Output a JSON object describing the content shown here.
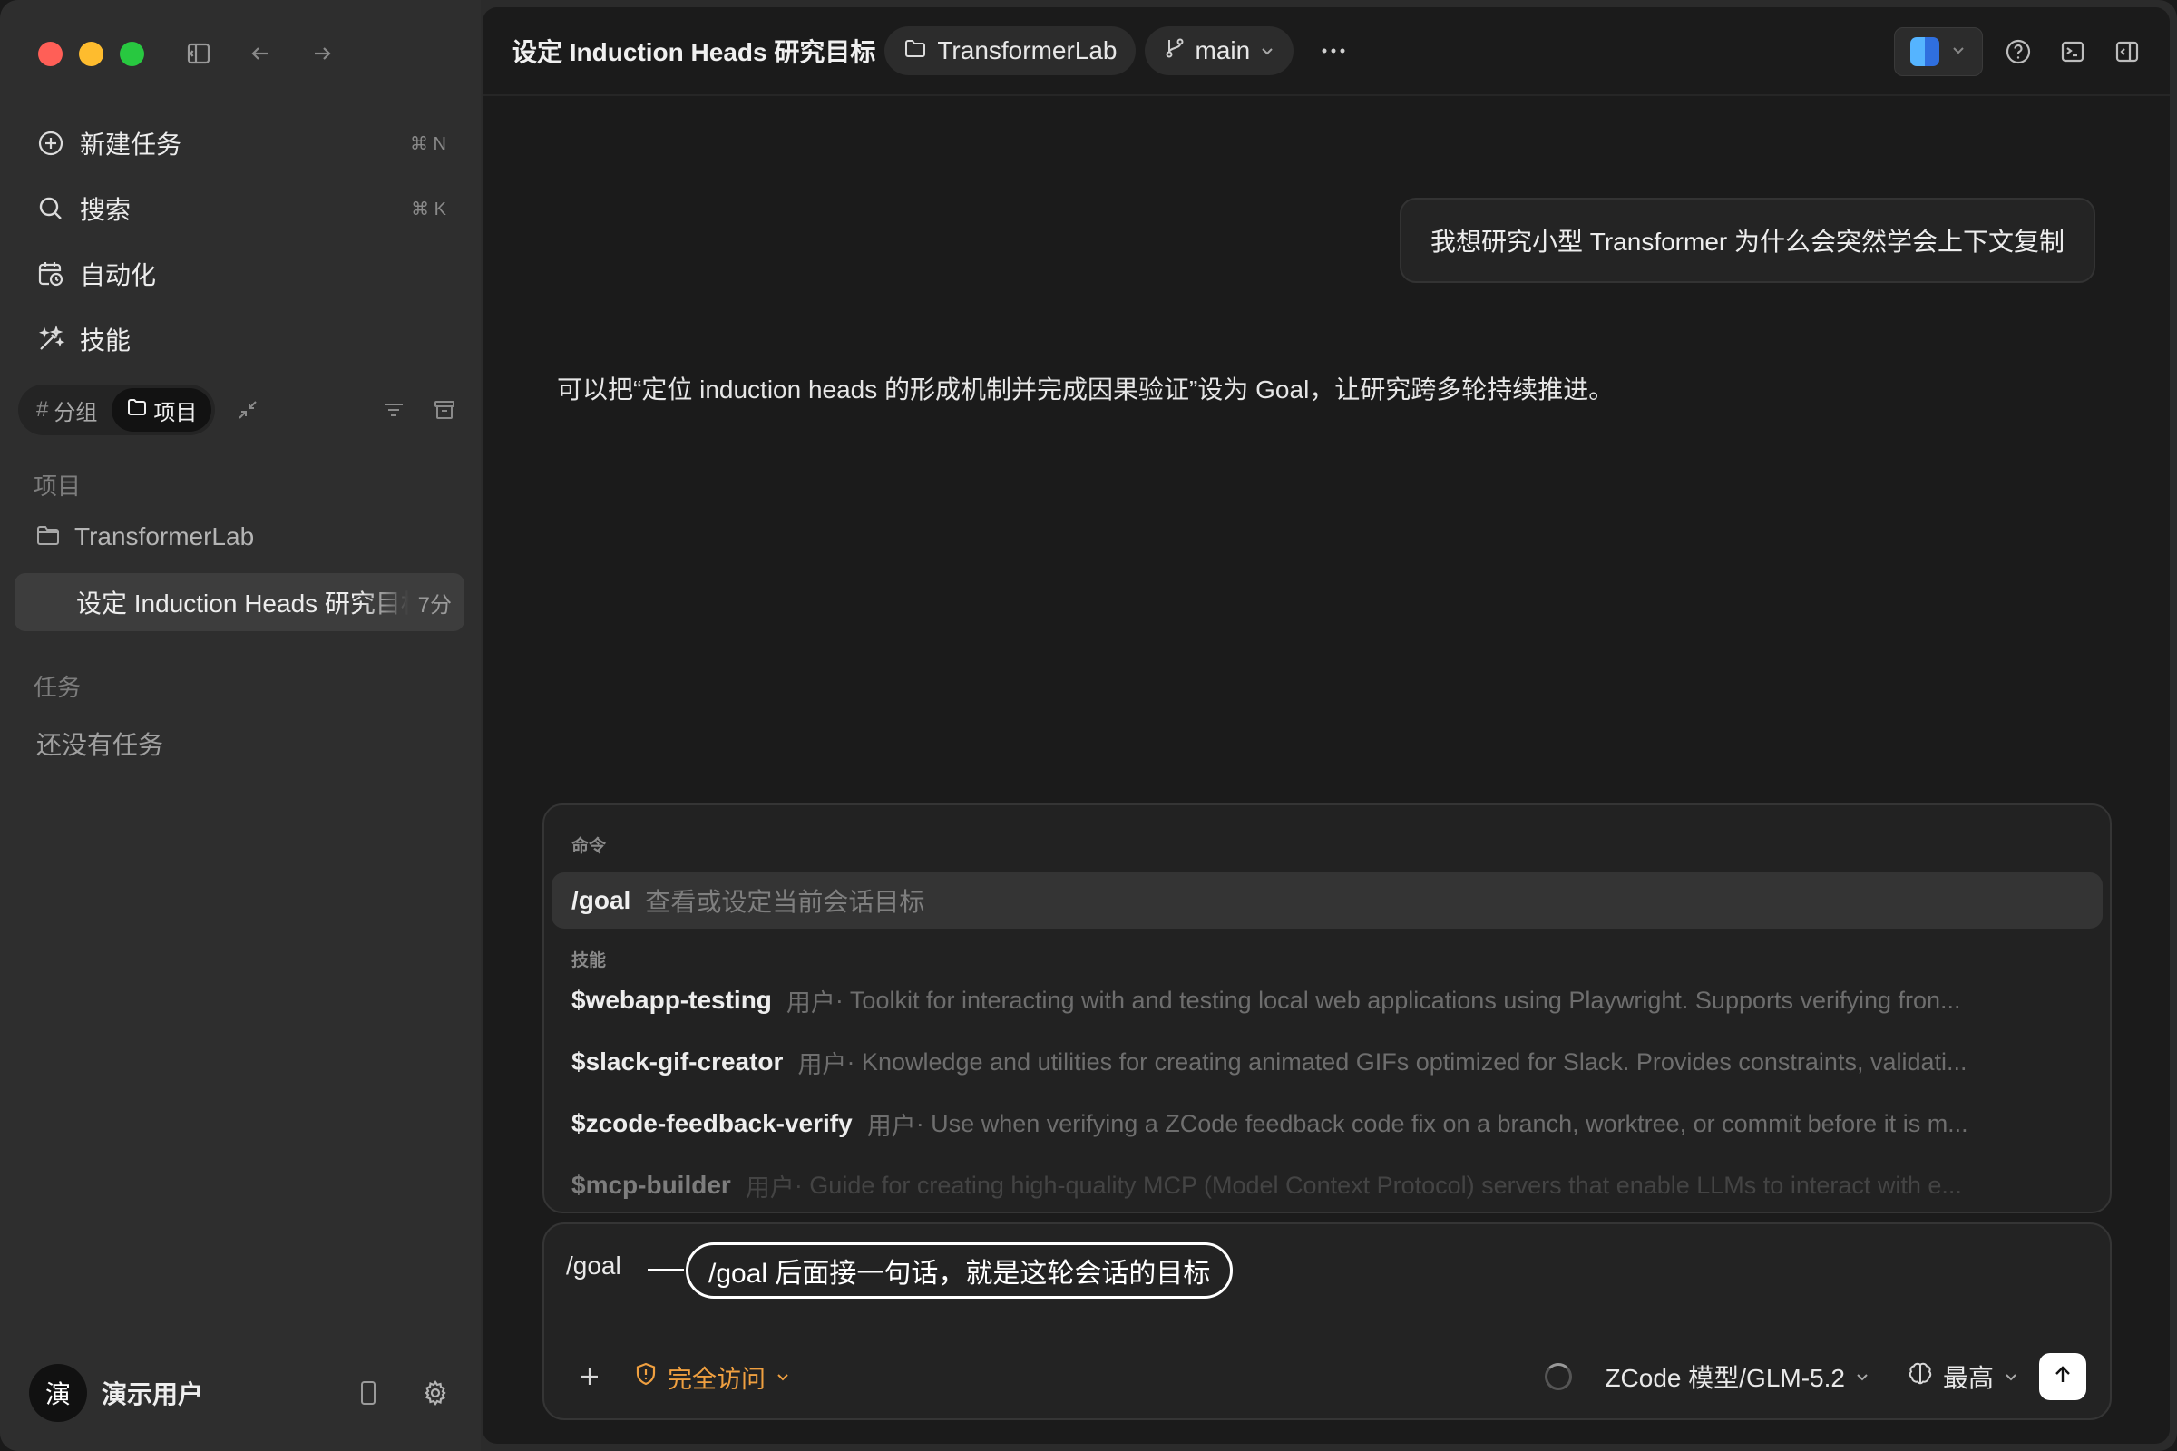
{
  "sidebar": {
    "nav": [
      {
        "label": "新建任务",
        "shortcut": "⌘ N"
      },
      {
        "label": "搜索",
        "shortcut": "⌘ K"
      },
      {
        "label": "自动化",
        "shortcut": ""
      },
      {
        "label": "技能",
        "shortcut": ""
      }
    ],
    "segment": {
      "groups": "分组",
      "projects": "项目"
    },
    "projects_heading": "项目",
    "project_name": "TransformerLab",
    "active_task": {
      "title": "设定 Induction Heads 研究目标",
      "time": "7分"
    },
    "tasks_heading": "任务",
    "tasks_empty": "还没有任务",
    "user": {
      "avatar_char": "演",
      "name": "演示用户"
    }
  },
  "header": {
    "title": "设定 Induction Heads 研究目标",
    "project": "TransformerLab",
    "branch": "main"
  },
  "conversation": {
    "user_message": "我想研究小型 Transformer 为什么会突然学会上下文复制",
    "assistant_message": "可以把“定位 induction heads 的形成机制并完成因果验证”设为 Goal，让研究跨多轮持续推进。"
  },
  "popup": {
    "commands_label": "命令",
    "command": {
      "name": "/goal",
      "desc": "查看或设定当前会话目标"
    },
    "skills_label": "技能",
    "skills": [
      {
        "name": "$webapp-testing",
        "source": "用户",
        "desc": " · Toolkit for interacting with and testing local web applications using Playwright. Supports verifying fron..."
      },
      {
        "name": "$slack-gif-creator",
        "source": "用户",
        "desc": " · Knowledge and utilities for creating animated GIFs optimized for Slack. Provides constraints, validati..."
      },
      {
        "name": "$zcode-feedback-verify",
        "source": "用户",
        "desc": " · Use when verifying a ZCode feedback code fix on a branch, worktree, or commit before it is m..."
      },
      {
        "name": "$mcp-builder",
        "source": "用户",
        "desc": " · Guide for creating high-quality MCP (Model Context Protocol) servers that enable LLMs to interact with e..."
      }
    ]
  },
  "composer": {
    "input_value": "/goal",
    "callout": "/goal 后面接一句话，就是这轮会话的目标",
    "access_label": "完全访问",
    "model_label": "ZCode 模型/GLM-5.2",
    "effort_label": "最高"
  },
  "colors": {
    "accent_warning": "#f0a040",
    "traffic_red": "#ff5f57",
    "traffic_yellow": "#febc2e",
    "traffic_green": "#28c840"
  }
}
